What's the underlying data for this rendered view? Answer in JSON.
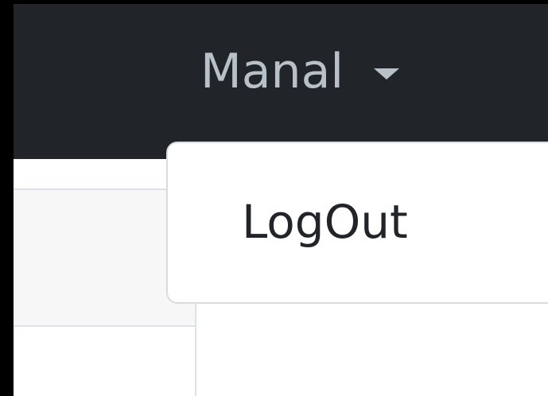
{
  "navbar": {
    "user_name": "Manal",
    "caret_icon": "caret-down-icon",
    "background": "#212529",
    "text_color": "#b9c1c8"
  },
  "user_menu": {
    "items": [
      {
        "label": "LogOut"
      }
    ]
  }
}
